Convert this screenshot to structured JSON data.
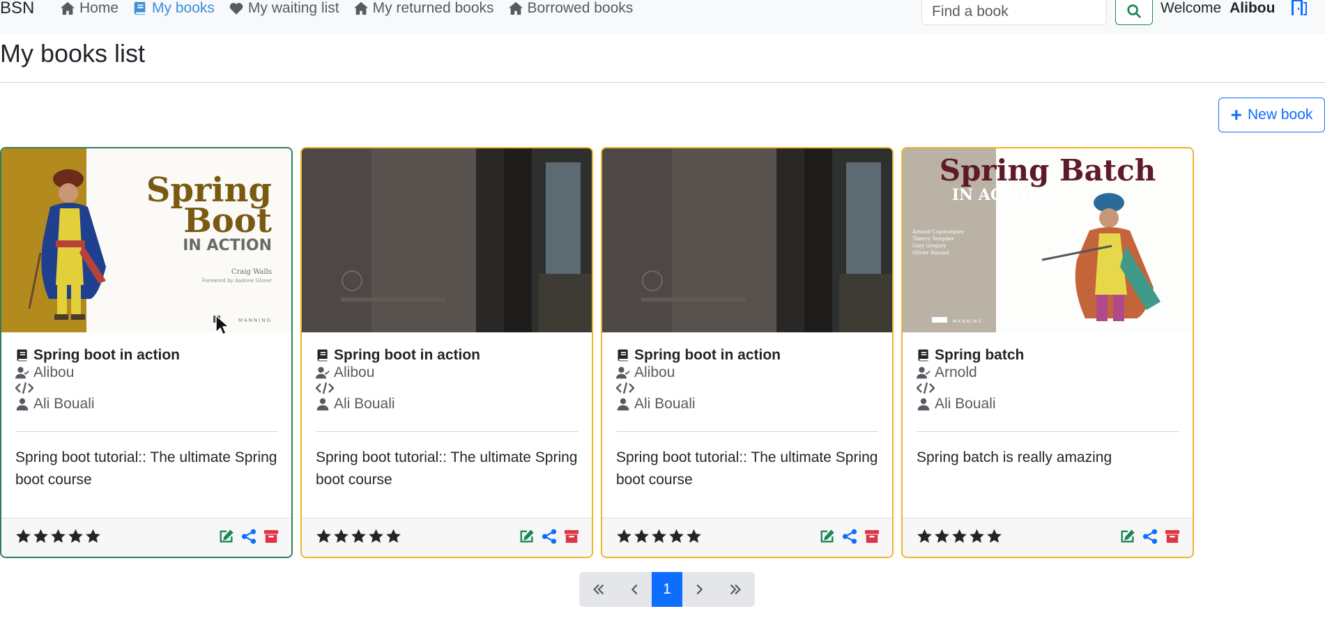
{
  "navbar": {
    "brand": "BSN",
    "items": [
      {
        "label": "Home",
        "icon": "home-icon",
        "active": false
      },
      {
        "label": "My books",
        "icon": "book-icon",
        "active": true
      },
      {
        "label": "My waiting list",
        "icon": "heart-icon",
        "active": false
      },
      {
        "label": "My returned books",
        "icon": "home-icon",
        "active": false
      },
      {
        "label": "Borrowed books",
        "icon": "home-icon",
        "active": false
      }
    ],
    "search_placeholder": "Find a book",
    "welcome_label": "Welcome",
    "username": "Alibou"
  },
  "page": {
    "title": "My books list",
    "new_book_label": "New book"
  },
  "books": [
    {
      "title": "Spring boot in action",
      "owner": "Alibou",
      "isbn": "",
      "author": "Ali Bouali",
      "synopsis": "Spring boot tutorial:: The ultimate Spring boot course",
      "rating": 5,
      "cover": "spring-boot-in-action-cover",
      "border_color": "#2e7d5b"
    },
    {
      "title": "Spring boot in action",
      "owner": "Alibou",
      "isbn": "",
      "author": "Ali Bouali",
      "synopsis": "Spring boot tutorial:: The ultimate Spring boot course",
      "rating": 5,
      "cover": "building-entrance-photo",
      "border_color": "#f0b429"
    },
    {
      "title": "Spring boot in action",
      "owner": "Alibou",
      "isbn": "",
      "author": "Ali Bouali",
      "synopsis": "Spring boot tutorial:: The ultimate Spring boot course",
      "rating": 5,
      "cover": "building-entrance-photo",
      "border_color": "#f0b429"
    },
    {
      "title": "Spring batch",
      "owner": "Arnold",
      "isbn": "",
      "author": "Ali Bouali",
      "synopsis": "Spring batch is really amazing",
      "rating": 5,
      "cover": "spring-batch-in-action-cover",
      "border_color": "#f0b429"
    }
  ],
  "cover_text": {
    "boot_line1": "Spring",
    "boot_line2": "Boot",
    "boot_line3": "IN ACTION",
    "boot_author": "Craig Walls",
    "boot_foreword": "Foreword by Andrew Glover",
    "boot_publisher": "MANNING",
    "batch_line1": "Spring Batch",
    "batch_line2": "IN ACTION",
    "batch_authors": [
      "Arnaud Cogoluègnes",
      "Thierry Templier",
      "Gary Gregory",
      "Olivier Bazoud"
    ],
    "batch_publisher": "MANNING"
  },
  "pagination": {
    "current_page": "1"
  },
  "colors": {
    "primary": "#0d6efd",
    "success": "#198754",
    "danger": "#dc3545",
    "card_border": "#f0b429"
  }
}
